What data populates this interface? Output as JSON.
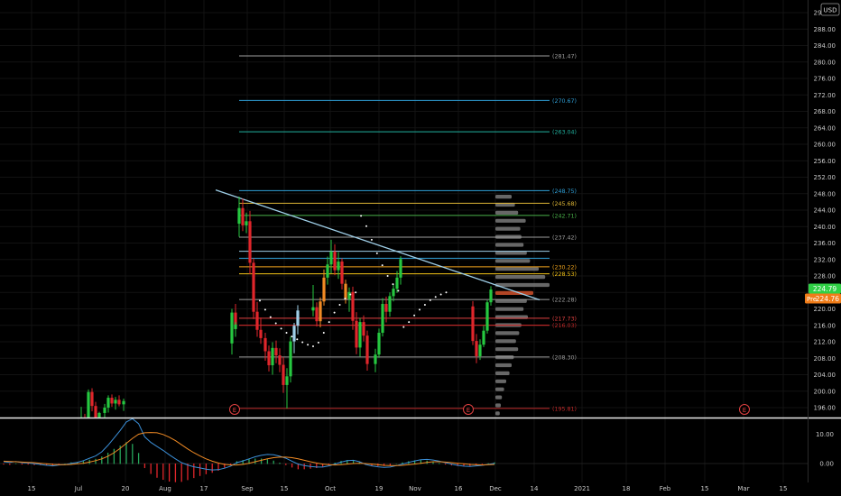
{
  "currency": "USD",
  "colors": {
    "background": "#000000",
    "grid": "#121212",
    "axis_text": "#c8c8c8",
    "up": "#26c840",
    "down": "#e0262b",
    "trendline": "#9fcfe8",
    "last_price_badge": "#2fd045",
    "pre_badge": "#f07c18",
    "earnings": "#e04040",
    "macd_line": "#3b8fd8",
    "signal_line": "#f08a24"
  },
  "price_axis_labels": [
    "196.00",
    "200.00",
    "204.00",
    "208.00",
    "212.00",
    "216.00",
    "220.00",
    "224.00",
    "228.00",
    "232.00",
    "236.00",
    "240.00",
    "244.00",
    "248.00",
    "252.00",
    "256.00",
    "260.00",
    "264.00",
    "268.00",
    "272.00",
    "276.00",
    "280.00",
    "284.00",
    "288.00",
    "292.00"
  ],
  "price_badges": {
    "last": "224.79",
    "pre_label": "Pre",
    "pre": "224.76"
  },
  "macd_axis_labels": [
    "10.00",
    "0.00"
  ],
  "time_axis_labels": [
    "15",
    "Jul",
    "20",
    "Aug",
    "17",
    "Sep",
    "15",
    "Oct",
    "19",
    "Nov",
    "16",
    "Dec",
    "14",
    "2021",
    "18",
    "Feb",
    "15",
    "Mar",
    "15"
  ],
  "level_lines": [
    {
      "label": "(281.47)",
      "value": 281.47,
      "color": "#9e9e9e"
    },
    {
      "label": "(270.67)",
      "value": 270.67,
      "color": "#2f9fd6"
    },
    {
      "label": "(263.04)",
      "value": 263.04,
      "color": "#22b3a0"
    },
    {
      "label": "(248.75)",
      "value": 248.75,
      "color": "#2f9fd6"
    },
    {
      "label": "(245.68)",
      "value": 245.68,
      "color": "#dcb535"
    },
    {
      "label": "(242.71)",
      "value": 242.71,
      "color": "#4ab24a"
    },
    {
      "label": "(237.42)",
      "value": 237.42,
      "color": "#9e9e9e"
    },
    {
      "label": "",
      "value": 234.0,
      "color": "#9fcfe8"
    },
    {
      "label": "",
      "value": 232.3,
      "color": "#2f9fd6"
    },
    {
      "label": "(230.22)",
      "value": 230.22,
      "color": "#f0a41c"
    },
    {
      "label": "(228.53)",
      "value": 228.53,
      "color": "#f5c518"
    },
    {
      "label": "(222.28)",
      "value": 222.28,
      "color": "#9e9e9e"
    },
    {
      "label": "(217.73)",
      "value": 217.73,
      "color": "#e04040"
    },
    {
      "label": "(216.03)",
      "value": 216.03,
      "color": "#c02828"
    },
    {
      "label": "(208.30)",
      "value": 208.3,
      "color": "#9e9e9e"
    },
    {
      "label": "(195.81)",
      "value": 195.81,
      "color": "#c02828"
    }
  ],
  "earnings_marker": "E",
  "chart_data": {
    "type": "candlestick",
    "ylim": [
      193.5,
      293
    ],
    "trendline": {
      "from": [
        0,
        248.9
      ],
      "to": [
        62,
        222.2
      ]
    },
    "candles": [
      [
        189.7,
        196.2,
        186.0,
        193.4
      ],
      [
        193.4,
        194.5,
        189.8,
        191.1
      ],
      [
        191.1,
        200.4,
        190.3,
        199.8
      ],
      [
        199.8,
        200.7,
        195.1,
        196.4
      ],
      [
        196.4,
        197.4,
        192.0,
        193.2
      ],
      [
        193.2,
        195.0,
        190.5,
        194.7
      ],
      [
        194.7,
        196.9,
        193.0,
        196.0
      ],
      [
        196.0,
        199.0,
        194.8,
        198.4
      ],
      [
        198.4,
        199.2,
        196.2,
        197.0
      ],
      [
        197.0,
        198.6,
        195.5,
        197.9
      ],
      [
        197.9,
        199.0,
        196.3,
        196.8
      ],
      [
        196.8,
        198.2,
        195.2,
        197.6
      ],
      [
        211.6,
        220.0,
        208.9,
        219.1
      ],
      [
        219.1,
        221.2,
        213.9,
        215.1
      ],
      [
        215.1,
        216.8,
        213.2,
        216.2
      ],
      [
        240.7,
        247.3,
        237.5,
        244.5
      ],
      [
        244.5,
        246.8,
        238.9,
        240.3
      ],
      [
        240.3,
        243.4,
        238.4,
        241.3
      ],
      [
        241.3,
        243.8,
        228.4,
        231.2
      ],
      [
        231.2,
        232.3,
        217.5,
        219.3
      ],
      [
        219.3,
        221.7,
        213.2,
        214.9
      ],
      [
        214.9,
        217.9,
        211.5,
        212.9
      ],
      [
        212.9,
        214.2,
        207.4,
        209.7
      ],
      [
        209.7,
        211.1,
        204.8,
        206.3
      ],
      [
        206.3,
        211.9,
        204.0,
        210.5
      ],
      [
        210.5,
        212.3,
        206.8,
        208.7
      ],
      [
        208.7,
        210.4,
        204.6,
        206.4
      ],
      [
        206.4,
        208.3,
        199.6,
        201.5
      ],
      [
        201.5,
        205.6,
        195.8,
        203.6
      ],
      [
        203.6,
        213.2,
        202.1,
        212.1
      ],
      [
        212.1,
        216.6,
        209.2,
        215.9
      ],
      [
        215.9,
        220.9,
        213.8,
        219.6
      ],
      [
        219.6,
        225.8,
        218.2,
        220.4
      ],
      [
        220.4,
        221.6,
        215.7,
        217.0
      ],
      [
        217.0,
        222.8,
        215.5,
        221.8
      ],
      [
        221.8,
        229.6,
        220.8,
        227.6
      ],
      [
        227.6,
        232.7,
        225.9,
        230.8
      ],
      [
        230.8,
        236.8,
        228.6,
        233.9
      ],
      [
        233.9,
        235.7,
        228.2,
        229.4
      ],
      [
        229.4,
        233.8,
        227.3,
        231.5
      ],
      [
        231.5,
        232.3,
        224.7,
        226.1
      ],
      [
        226.1,
        227.1,
        221.3,
        222.4
      ],
      [
        222.4,
        225.2,
        219.3,
        224.1
      ],
      [
        224.1,
        225.4,
        214.9,
        217.1
      ],
      [
        217.1,
        219.2,
        209.0,
        210.6
      ],
      [
        210.6,
        217.8,
        208.4,
        216.8
      ],
      [
        216.8,
        218.4,
        212.1,
        213.5
      ],
      [
        213.5,
        214.7,
        205.0,
        206.6
      ],
      [
        206.6,
        210.3,
        204.6,
        208.9
      ],
      [
        208.9,
        215.2,
        208.1,
        214.2
      ],
      [
        214.2,
        222.6,
        213.3,
        221.2
      ],
      [
        221.2,
        223.0,
        216.7,
        219.3
      ],
      [
        219.3,
        224.0,
        218.1,
        223.1
      ],
      [
        223.1,
        226.0,
        221.8,
        224.9
      ],
      [
        224.9,
        229.2,
        223.9,
        227.6
      ],
      [
        227.6,
        232.8,
        225.9,
        232.1
      ],
      [
        220.6,
        221.9,
        211.2,
        212.2
      ],
      [
        212.2,
        213.9,
        206.8,
        208.5
      ],
      [
        208.5,
        212.6,
        207.6,
        211.3
      ],
      [
        211.3,
        215.9,
        210.7,
        214.7
      ],
      [
        214.7,
        222.1,
        214.0,
        221.6
      ],
      [
        221.6,
        225.5,
        220.8,
        224.7
      ]
    ],
    "sar": [
      222.0,
      219.8,
      218.0,
      216.5,
      215.2,
      214.2,
      213.3,
      212.6,
      211.9,
      211.3,
      210.9,
      211.8,
      214.2,
      216.8,
      219.1,
      221.0,
      222.5,
      223.5,
      224.0,
      242.6,
      240.1,
      236.8,
      233.5,
      230.6,
      228.0,
      226.0,
      224.4,
      215.6,
      216.8,
      218.4,
      219.8,
      221.0,
      222.1,
      222.9,
      223.5,
      224.0
    ],
    "volume_profile": [
      0.3,
      0.36,
      0.42,
      0.56,
      0.46,
      0.48,
      0.52,
      0.58,
      0.64,
      0.8,
      0.92,
      1.0,
      0.7,
      0.58,
      0.52,
      0.6,
      0.48,
      0.44,
      0.38,
      0.42,
      0.34,
      0.3,
      0.26,
      0.2,
      0.16,
      0.12,
      0.1,
      0.08
    ],
    "macd": [
      0.6,
      0.4,
      0.7,
      0.3,
      0.2,
      -0.1,
      -0.3,
      -0.6,
      -0.8,
      -0.5,
      -0.4,
      0.1,
      0.4,
      1.0,
      1.8,
      2.6,
      4.0,
      6.2,
      8.7,
      11.3,
      14.2,
      15.3,
      13.6,
      9.1,
      7.2,
      5.8,
      4.5,
      3.0,
      1.6,
      0.3,
      -0.5,
      -1.1,
      -1.5,
      -1.9,
      -2.2,
      -2.1,
      -1.6,
      -0.9,
      0.3,
      0.9,
      1.6,
      2.3,
      2.8,
      3.1,
      3.0,
      2.5,
      1.8,
      0.8,
      -0.2,
      -0.7,
      -1.0,
      -1.2,
      -1.2,
      -0.8,
      -0.2,
      0.5,
      1.0,
      1.1,
      0.6,
      -0.3,
      -0.8,
      -1.1,
      -1.3,
      -1.2,
      -0.7,
      -0.2,
      0.4,
      0.9,
      1.3,
      1.4,
      1.2,
      0.8,
      0.3,
      -0.2,
      -0.6,
      -0.9,
      -1.0,
      -0.8,
      -0.6,
      -0.3,
      0.1
    ],
    "signal": [
      0.8,
      0.7,
      0.6,
      0.5,
      0.4,
      0.3,
      0.1,
      -0.1,
      -0.3,
      -0.4,
      -0.4,
      -0.3,
      -0.1,
      0.1,
      0.5,
      1.0,
      1.6,
      2.5,
      3.7,
      5.2,
      6.9,
      8.6,
      10.0,
      10.5,
      10.6,
      10.5,
      9.9,
      9.0,
      7.8,
      6.4,
      5.0,
      3.7,
      2.6,
      1.6,
      0.8,
      0.2,
      -0.3,
      -0.5,
      -0.5,
      -0.3,
      0.1,
      0.6,
      1.1,
      1.6,
      2.0,
      2.2,
      2.2,
      2.0,
      1.6,
      1.1,
      0.6,
      0.2,
      -0.2,
      -0.4,
      -0.5,
      -0.4,
      -0.2,
      0.0,
      0.1,
      0.0,
      -0.2,
      -0.4,
      -0.6,
      -0.7,
      -0.7,
      -0.6,
      -0.4,
      -0.2,
      0.1,
      0.4,
      0.6,
      0.6,
      0.5,
      0.3,
      0.1,
      -0.1,
      -0.3,
      -0.4,
      -0.5,
      -0.4,
      -0.3
    ],
    "macd_ylim": [
      -4,
      19
    ]
  }
}
